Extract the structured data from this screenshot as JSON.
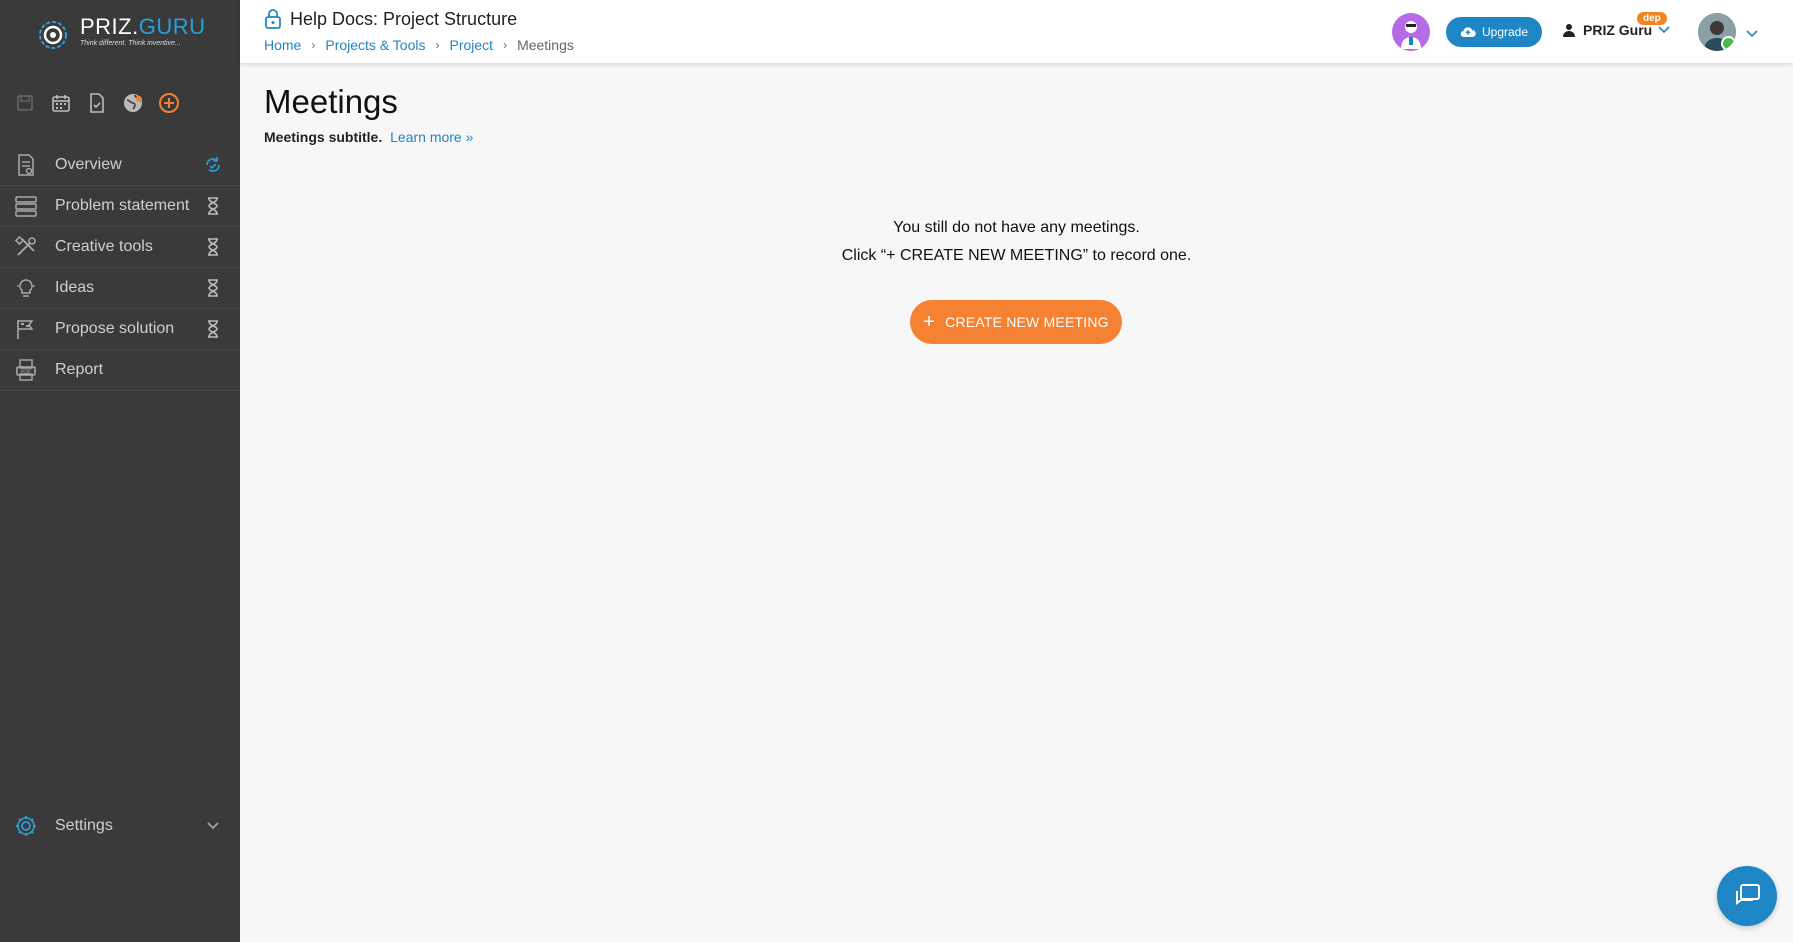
{
  "brand": {
    "name_part1": "PRIZ.",
    "name_part2": "GURU",
    "tagline": "Think different. Think inventive..."
  },
  "sidebar": {
    "quick_icons": [
      "floppy-icon",
      "calendar-icon",
      "document-check-icon",
      "globe-icon",
      "add-circle-icon"
    ],
    "items": [
      {
        "label": "Overview",
        "icon": "document-eye-icon",
        "status": "sync-icon"
      },
      {
        "label": "Problem statement",
        "icon": "stack-icon",
        "status": "hourglass-icon"
      },
      {
        "label": "Creative tools",
        "icon": "tools-icon",
        "status": "hourglass-icon"
      },
      {
        "label": "Ideas",
        "icon": "lightbulb-icon",
        "status": "hourglass-icon"
      },
      {
        "label": "Propose solution",
        "icon": "flag-icon",
        "status": "hourglass-icon"
      },
      {
        "label": "Report",
        "icon": "pdf-icon",
        "status": ""
      }
    ],
    "settings_label": "Settings"
  },
  "header": {
    "title": "Help Docs: Project Structure",
    "breadcrumbs": [
      "Home",
      "Projects & Tools",
      "Project",
      "Meetings"
    ],
    "upgrade_label": "Upgrade",
    "workspace_name": "PRIZ Guru",
    "workspace_badge": "dep"
  },
  "main": {
    "title": "Meetings",
    "subtitle": "Meetings subtitle.",
    "learn_more": "Learn more »",
    "empty_line1": "You still do not have any meetings.",
    "empty_line2": "Click “+ CREATE NEW MEETING” to record one.",
    "create_label": "CREATE NEW MEETING",
    "create_plus": "+"
  },
  "colors": {
    "sidebar_bg": "#3a3a3a",
    "accent_blue": "#1f86c6",
    "accent_orange": "#f58233",
    "page_bg": "#f7f7f7"
  }
}
